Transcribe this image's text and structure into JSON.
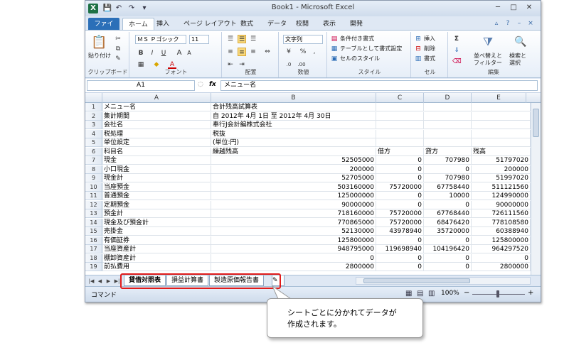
{
  "window": {
    "title": "Book1 - Microsoft Excel",
    "app_icon_letter": "X",
    "controls": [
      "─",
      "□",
      "✕"
    ],
    "qat": [
      "💾",
      "↶",
      "↷",
      "▾"
    ]
  },
  "ribbon_tabs": [
    "ファイル",
    "ホーム",
    "挿入",
    "ページ レイアウト",
    "数式",
    "データ",
    "校閲",
    "表示",
    "開発"
  ],
  "ribbon": {
    "clipboard": {
      "paste": "貼り付け",
      "label": "クリップボード"
    },
    "font": {
      "name": "ＭＳ Ｐゴシック",
      "size": "11",
      "bold": "B",
      "italic": "I",
      "underline": "U",
      "grow": "A",
      "shrink": "A",
      "color_a": "A",
      "label": "フォント"
    },
    "alignment": {
      "label": "配置"
    },
    "number": {
      "format": "文字列",
      "percent": "%",
      "comma": ",",
      "label": "数値"
    },
    "styles": {
      "cond": "条件付き書式",
      "table": "テーブルとして書式設定",
      "cell": "セルのスタイル",
      "label": "スタイル"
    },
    "cells": {
      "insert": "挿入",
      "delete": "削除",
      "format": "書式",
      "label": "セル"
    },
    "editing": {
      "sigma": "Σ",
      "sort": "並べ替えと",
      "sort2": "フィルター",
      "find": "検索と",
      "find2": "選択",
      "label": "編集"
    }
  },
  "formula_bar": {
    "cell": "A1",
    "fx": "fx",
    "value": "メニュー名"
  },
  "columns": [
    "A",
    "B",
    "C",
    "D",
    "E"
  ],
  "rows": [
    {
      "n": "1",
      "a": "メニュー名",
      "b": "合計残高試算表",
      "c": "",
      "d": "",
      "e": ""
    },
    {
      "n": "2",
      "a": "集計期間",
      "b": "自 2012年 4月 1日 至 2012年 4月 30日",
      "c": "",
      "d": "",
      "e": ""
    },
    {
      "n": "3",
      "a": "会社名",
      "b": "奉行J会計編株式会社",
      "c": "",
      "d": "",
      "e": ""
    },
    {
      "n": "4",
      "a": "税処理",
      "b": "税抜",
      "c": "",
      "d": "",
      "e": ""
    },
    {
      "n": "5",
      "a": "単位設定",
      "b": "(単位:円)",
      "c": "",
      "d": "",
      "e": ""
    },
    {
      "n": "6",
      "a": "科目名",
      "b": "繰越残高",
      "c": "借方",
      "d": "貸方",
      "e": "残高"
    },
    {
      "n": "7",
      "a": "現金",
      "b": "52505000",
      "c": "0",
      "d": "707980",
      "e": "51797020"
    },
    {
      "n": "8",
      "a": "小口現金",
      "b": "200000",
      "c": "0",
      "d": "0",
      "e": "200000"
    },
    {
      "n": "9",
      "a": "現金計",
      "b": "52705000",
      "c": "0",
      "d": "707980",
      "e": "51997020"
    },
    {
      "n": "10",
      "a": "当座預金",
      "b": "503160000",
      "c": "75720000",
      "d": "67758440",
      "e": "511121560"
    },
    {
      "n": "11",
      "a": "普通預金",
      "b": "125000000",
      "c": "0",
      "d": "10000",
      "e": "124990000"
    },
    {
      "n": "12",
      "a": "定期預金",
      "b": "90000000",
      "c": "0",
      "d": "0",
      "e": "90000000"
    },
    {
      "n": "13",
      "a": "預金計",
      "b": "718160000",
      "c": "75720000",
      "d": "67768440",
      "e": "726111560"
    },
    {
      "n": "14",
      "a": "現金及び預金計",
      "b": "770865000",
      "c": "75720000",
      "d": "68476420",
      "e": "778108580"
    },
    {
      "n": "15",
      "a": "売掛金",
      "b": "52130000",
      "c": "43978940",
      "d": "35720000",
      "e": "60388940"
    },
    {
      "n": "16",
      "a": "有価証券",
      "b": "125800000",
      "c": "0",
      "d": "0",
      "e": "125800000"
    },
    {
      "n": "17",
      "a": "当座資産計",
      "b": "948795000",
      "c": "119698940",
      "d": "104196420",
      "e": "964297520"
    },
    {
      "n": "18",
      "a": "棚卸資産計",
      "b": "0",
      "c": "0",
      "d": "0",
      "e": "0"
    },
    {
      "n": "19",
      "a": "前払費用",
      "b": "2800000",
      "c": "0",
      "d": "0",
      "e": "2800000"
    }
  ],
  "sheet_tabs": [
    "貸借対照表",
    "損益計算書",
    "製造原価報告書"
  ],
  "status": {
    "mode": "コマンド",
    "zoom": "100%",
    "minus": "−",
    "plus": "+"
  },
  "callout": {
    "line1": "シートごとに分かれてデータが",
    "line2": "作成されます。"
  }
}
